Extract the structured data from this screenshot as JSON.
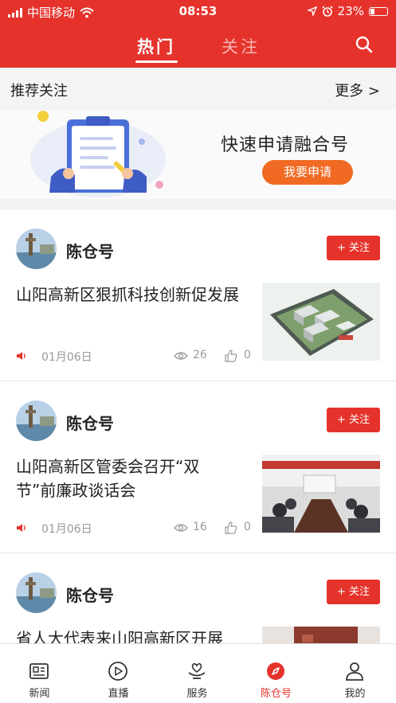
{
  "status_bar": {
    "carrier": "中国移动",
    "time": "08:53",
    "battery_percent": "23%",
    "battery_level": 0.23
  },
  "top_tabs": [
    {
      "label": "热门",
      "active": true
    },
    {
      "label": "关注",
      "active": false
    }
  ],
  "recommend": {
    "title": "推荐关注",
    "more": "更多 >"
  },
  "banner": {
    "title": "快速申请融合号",
    "button": "我要申请"
  },
  "articles": [
    {
      "author": "陈仓号",
      "follow_label": "+ 关注",
      "headline": "山阳高新区狠抓科技创新促发展",
      "date": "01月06日",
      "views": "26",
      "likes": "0",
      "thumb_icon": "aerial-campus-photo"
    },
    {
      "author": "陈仓号",
      "follow_label": "+ 关注",
      "headline": "山阳高新区管委会召开“双节”前廉政谈话会",
      "date": "01月06日",
      "views": "16",
      "likes": "0",
      "thumb_icon": "meeting-room-photo"
    },
    {
      "author": "陈仓号",
      "follow_label": "+ 关注",
      "headline": "省人大代表来山阳高新区开展"
    }
  ],
  "bottom_nav": [
    {
      "label": "新闻",
      "icon": "news-icon",
      "active": false
    },
    {
      "label": "直播",
      "icon": "play-icon",
      "active": false
    },
    {
      "label": "服务",
      "icon": "service-icon",
      "active": false
    },
    {
      "label": "陈仓号",
      "icon": "compass-icon",
      "active": true
    },
    {
      "label": "我的",
      "icon": "user-icon",
      "active": false
    }
  ],
  "colors": {
    "brand_red": "#e5332c",
    "banner_button": "#f06a24",
    "meta_gray": "#999999"
  }
}
